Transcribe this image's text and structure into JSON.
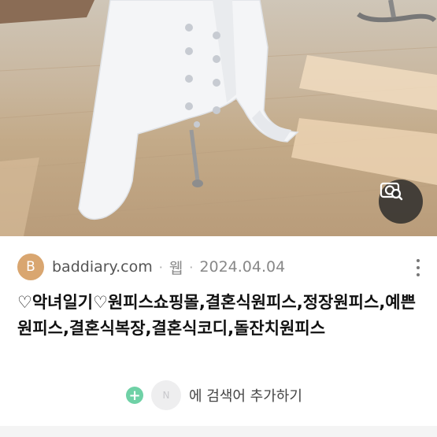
{
  "result": {
    "favicon_letter": "B",
    "source_domain": "baddiary.com",
    "separator": "·",
    "type_label": "웹",
    "date": "2024.04.04",
    "title": "♡악녀일기♡원피스쇼핑몰,결혼식원피스,정장원피스,예쁜원피스,결혼식복장,결혼식코디,돌잔치원피스",
    "image_icon": "image-search-icon",
    "more_icon": "more-vertical-icon"
  },
  "add_keyword": {
    "plus_label": "+",
    "chip_label": "N",
    "label": "에 검색어 추가하기"
  },
  "colors": {
    "accent_green": "#6fd1a6",
    "favicon_bg": "#d9a670"
  }
}
